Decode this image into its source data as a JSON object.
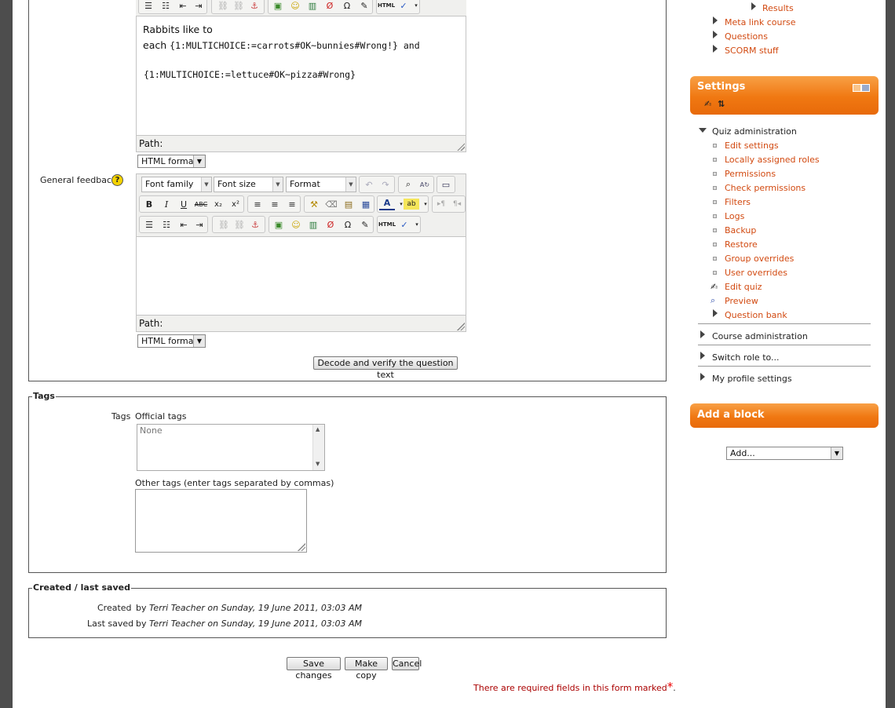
{
  "editor1": {
    "content_line1": "Rabbits like to",
    "content_line2_text": "each",
    "content_line2_code": "{1:MULTICHOICE:=carrots#OK~bunnies#Wrong!} and",
    "content_line3_code": "{1:MULTICHOICE:=lettuce#OK~pizza#Wrong}",
    "path_label": "Path:",
    "format": "HTML format"
  },
  "general_feedback": {
    "label": "General feedback",
    "help_glyph": "?",
    "font_family": "Font family",
    "font_size": "Font size",
    "format_select": "Format",
    "path_label": "Path:",
    "format": "HTML format"
  },
  "decode_button": "Decode and verify the question text",
  "tags": {
    "legend": "Tags",
    "label": "Tags",
    "official_label": "Official tags",
    "official_value": "None",
    "other_label": "Other tags (enter tags separated by commas)"
  },
  "created": {
    "legend": "Created / last saved",
    "created_label": "Created",
    "created_by": "by",
    "created_user": "Terri Teacher",
    "created_on": "on Sunday, 19 June 2011, 03:03 AM",
    "saved_label": "Last saved",
    "saved_by": "by",
    "saved_user": "Terri Teacher",
    "saved_on": "on Sunday, 19 June 2011, 03:03 AM"
  },
  "buttons": {
    "save": "Save changes",
    "copy": "Make copy",
    "cancel": "Cancel"
  },
  "required_note": "There are required fields in this form marked",
  "required_star": "*",
  "required_end": ".",
  "sidebar": {
    "nav_links": {
      "results": "Results",
      "meta": "Meta link course",
      "questions": "Questions",
      "scorm": "SCORM stuff"
    },
    "settings_title": "Settings",
    "quiz_admin": "Quiz administration",
    "quiz_items": [
      "Edit settings",
      "Locally assigned roles",
      "Permissions",
      "Check permissions",
      "Filters",
      "Logs",
      "Backup",
      "Restore",
      "Group overrides",
      "User overrides"
    ],
    "edit_quiz": "Edit quiz",
    "preview": "Preview",
    "question_bank": "Question bank",
    "course_admin": "Course administration",
    "switch_role": "Switch role to...",
    "profile": "My profile settings",
    "add_block_title": "Add a block",
    "add_select": "Add..."
  },
  "colors": {
    "link": "#d24a11",
    "block_header": "#f07812",
    "required": "#aa0000"
  }
}
